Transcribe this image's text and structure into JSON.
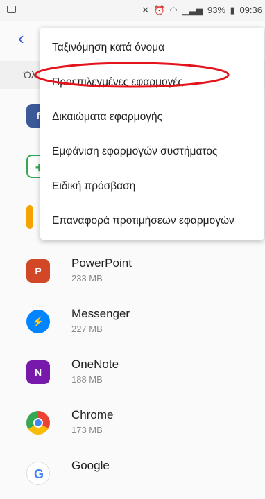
{
  "status_bar": {
    "battery": "93%",
    "time": "09:36",
    "icons": [
      "image-icon",
      "mute-icon",
      "alarm-icon",
      "wifi-icon",
      "signal-icon",
      "battery-icon"
    ]
  },
  "subheader": {
    "text": "Όλ"
  },
  "menu": {
    "items": [
      {
        "label": "Ταξινόμηση κατά όνομα"
      },
      {
        "label": "Προεπιλεγμένες εφαρμογές"
      },
      {
        "label": "Δικαιώματα εφαρμογής"
      },
      {
        "label": "Εμφάνιση εφαρμογών συστήματος"
      },
      {
        "label": "Ειδική πρόσβαση"
      },
      {
        "label": "Επαναφορά προτιμήσεων εφαρμογών"
      }
    ],
    "highlight_color": "#e3141c"
  },
  "apps": [
    {
      "name": "PowerPoint",
      "size": "233 MB",
      "icon": "powerpoint-icon",
      "color": "#d24726"
    },
    {
      "name": "Messenger",
      "size": "227 MB",
      "icon": "messenger-icon",
      "color": "#0084ff"
    },
    {
      "name": "OneNote",
      "size": "188 MB",
      "icon": "onenote-icon",
      "color": "#7719aa"
    },
    {
      "name": "Chrome",
      "size": "173 MB",
      "icon": "chrome-icon",
      "color": "#4285f4"
    },
    {
      "name": "Google",
      "size": "",
      "icon": "google-icon",
      "color": "#4285f4"
    }
  ],
  "partially_hidden_app_icons": [
    "facebook-icon",
    "play-games-icon",
    "app-icon"
  ],
  "accent_color": "#3b5bdb"
}
